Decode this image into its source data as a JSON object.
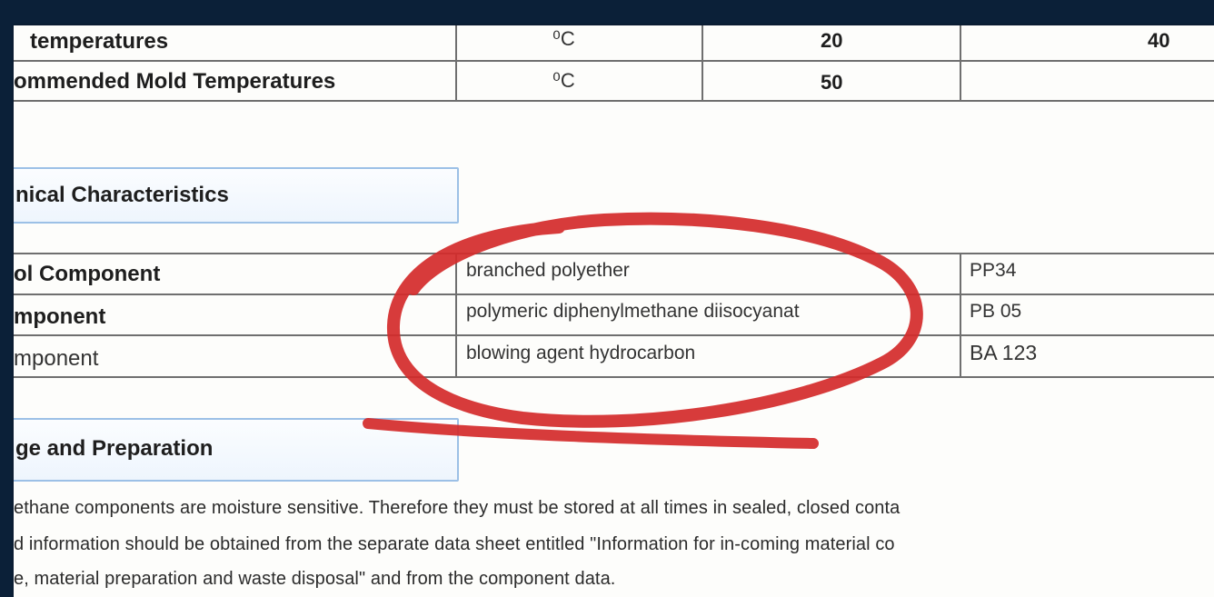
{
  "temperature_table": {
    "rows": [
      {
        "label": "temperatures",
        "unit": "⁰C",
        "value_a": "20",
        "value_b": "40"
      },
      {
        "label": "ommended Mold Temperatures",
        "unit": "⁰C",
        "value_a": "50",
        "value_b": ""
      }
    ]
  },
  "chemical_section": {
    "heading": "nical Characteristics"
  },
  "components_table": {
    "rows": [
      {
        "label": "ol Component",
        "description": "branched polyether",
        "code": "PP34"
      },
      {
        "label": "mponent",
        "description": "polymeric diphenylmethane diisocyanat",
        "code": "PB 05"
      },
      {
        "label": "mponent",
        "description": "blowing agent hydrocarbon",
        "code": "BA  123"
      }
    ]
  },
  "storage_section": {
    "heading": "ge and Preparation",
    "paragraph": [
      "ethane components are moisture sensitive. Therefore they must be stored at all times in sealed, closed conta",
      "d information should be obtained from the separate data sheet entitled \"Information for in-coming material co",
      "e, material preparation and waste disposal\" and from the component data."
    ]
  },
  "annotation": {
    "color": "#d42a2a"
  }
}
